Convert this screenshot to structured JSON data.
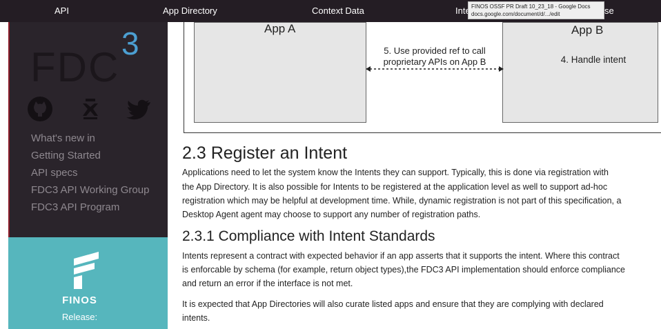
{
  "nav": {
    "items": [
      "API",
      "App Directory",
      "Context Data",
      "Inte",
      "se"
    ]
  },
  "tooltip": {
    "title": "FINOS OSSF PR Draft 10_23_18 - Google Docs",
    "url": "docs.google.com/document/d/.../edit"
  },
  "sidebar": {
    "logo_text": "FDC",
    "logo_superscript": "3",
    "social_icons": [
      "github-icon",
      "gitter-icon",
      "twitter-icon"
    ],
    "links": [
      "What's new in",
      "Getting Started",
      "API specs",
      "FDC3 API Working Group",
      "FDC3 API Program"
    ],
    "finos_name": "FINOS",
    "finos_release": "Release:"
  },
  "diagram": {
    "app_a": "App A",
    "app_b": "App B",
    "arrow_label_line1": "5. Use provided ref to call",
    "arrow_label_line2": "proprietary APIs on App B",
    "app_b_note": "4. Handle intent"
  },
  "doc": {
    "section_heading": "2.3 Register an Intent",
    "section_paragraph": [
      "Applications need to let the system know the Intents they can support. Typically, this is done via registration with",
      "the App Directory. It is also possible for Intents to be registered at the application level as well to support ad-hoc",
      "registration which may be helpful at development time. While, dynamic registration is not part of this specification, a",
      "Desktop Agent agent may choose to support any number of registration paths."
    ],
    "subsection_heading": "2.3.1 Compliance with Intent Standards",
    "subsection_paragraph": [
      "Intents represent a contract with expected behavior if an app asserts that it supports the intent. Where this contract",
      "is enforcable by schema (for example, return object types),the FDC3 API implementation should enforce compliance",
      "and return an error if the interface is not met."
    ],
    "closing_paragraph": [
      "It is expected that App Directories will also curate listed apps and ensure that they are complying with declared",
      "intents."
    ]
  },
  "colors": {
    "nav_bg": "#241d24",
    "sidebar_bg": "#2a242b",
    "accent_blue": "#4c9fd2",
    "finos_teal": "#56b6bd"
  }
}
